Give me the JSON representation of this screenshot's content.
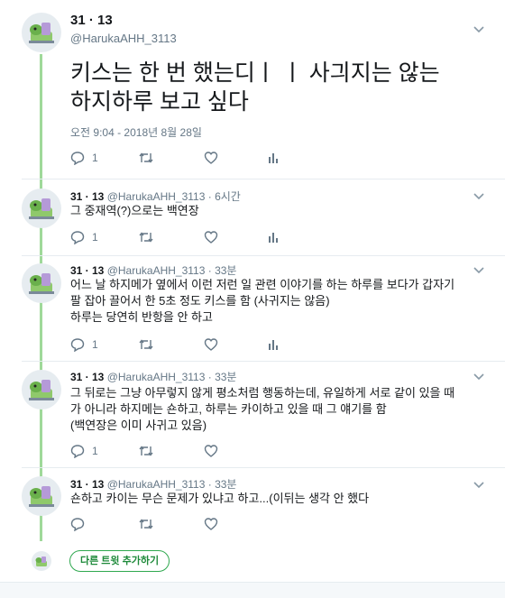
{
  "main": {
    "display_name": "31 · 13",
    "handle": "@HarukaAHH_3113",
    "text": "키스는 한 번 했는디ㅣ ㅣ 사긔지는 않는\n하지하루 보고 싶다",
    "timestamp": "오전 9:04 - 2018년 8월 28일",
    "reply_count": "1",
    "retweet_count": "",
    "like_count": ""
  },
  "replies": [
    {
      "display_name": "31 · 13",
      "handle": "@HarukaAHH_3113",
      "time": "6시간",
      "text": "그 중재역(?)으로는 백연장",
      "reply_count": "1"
    },
    {
      "display_name": "31 · 13",
      "handle": "@HarukaAHH_3113",
      "time": "33분",
      "text": "어느 날 하지메가 옆에서 이런 저런 일 관련 이야기를 하는 하루를 보다가 갑자기\n팔 잡아 끌어서 한 5초 정도 키스를 함 (사귀지는 않음)\n하루는 당연히 반항을 안 하고",
      "reply_count": "1"
    },
    {
      "display_name": "31 · 13",
      "handle": "@HarukaAHH_3113",
      "time": "33분",
      "text": "그 뒤로는 그냥 아무렇지 않게 평소처럼 행동하는데, 유일하게 서로 같이 있을 때\n가 아니라 하지메는 숀하고, 하루는 카이하고 있을 때 그 얘기를 함\n(백연장은 이미 사귀고 있음)",
      "reply_count": "1"
    },
    {
      "display_name": "31 · 13",
      "handle": "@HarukaAHH_3113",
      "time": "33분",
      "text": "숀하고 카이는 무슨 문제가 있냐고 하고...(이뒤는 생각 안 했다",
      "reply_count": ""
    }
  ],
  "add_button_label": "다른 트윗 추가하기",
  "separator": " · ",
  "icons": [
    "reply-icon",
    "retweet-icon",
    "like-icon",
    "analytics-icon",
    "chevron-down-icon"
  ],
  "colors": {
    "thread_line": "#9fd99a",
    "button_border": "#2fa84f",
    "muted": "#657786"
  }
}
